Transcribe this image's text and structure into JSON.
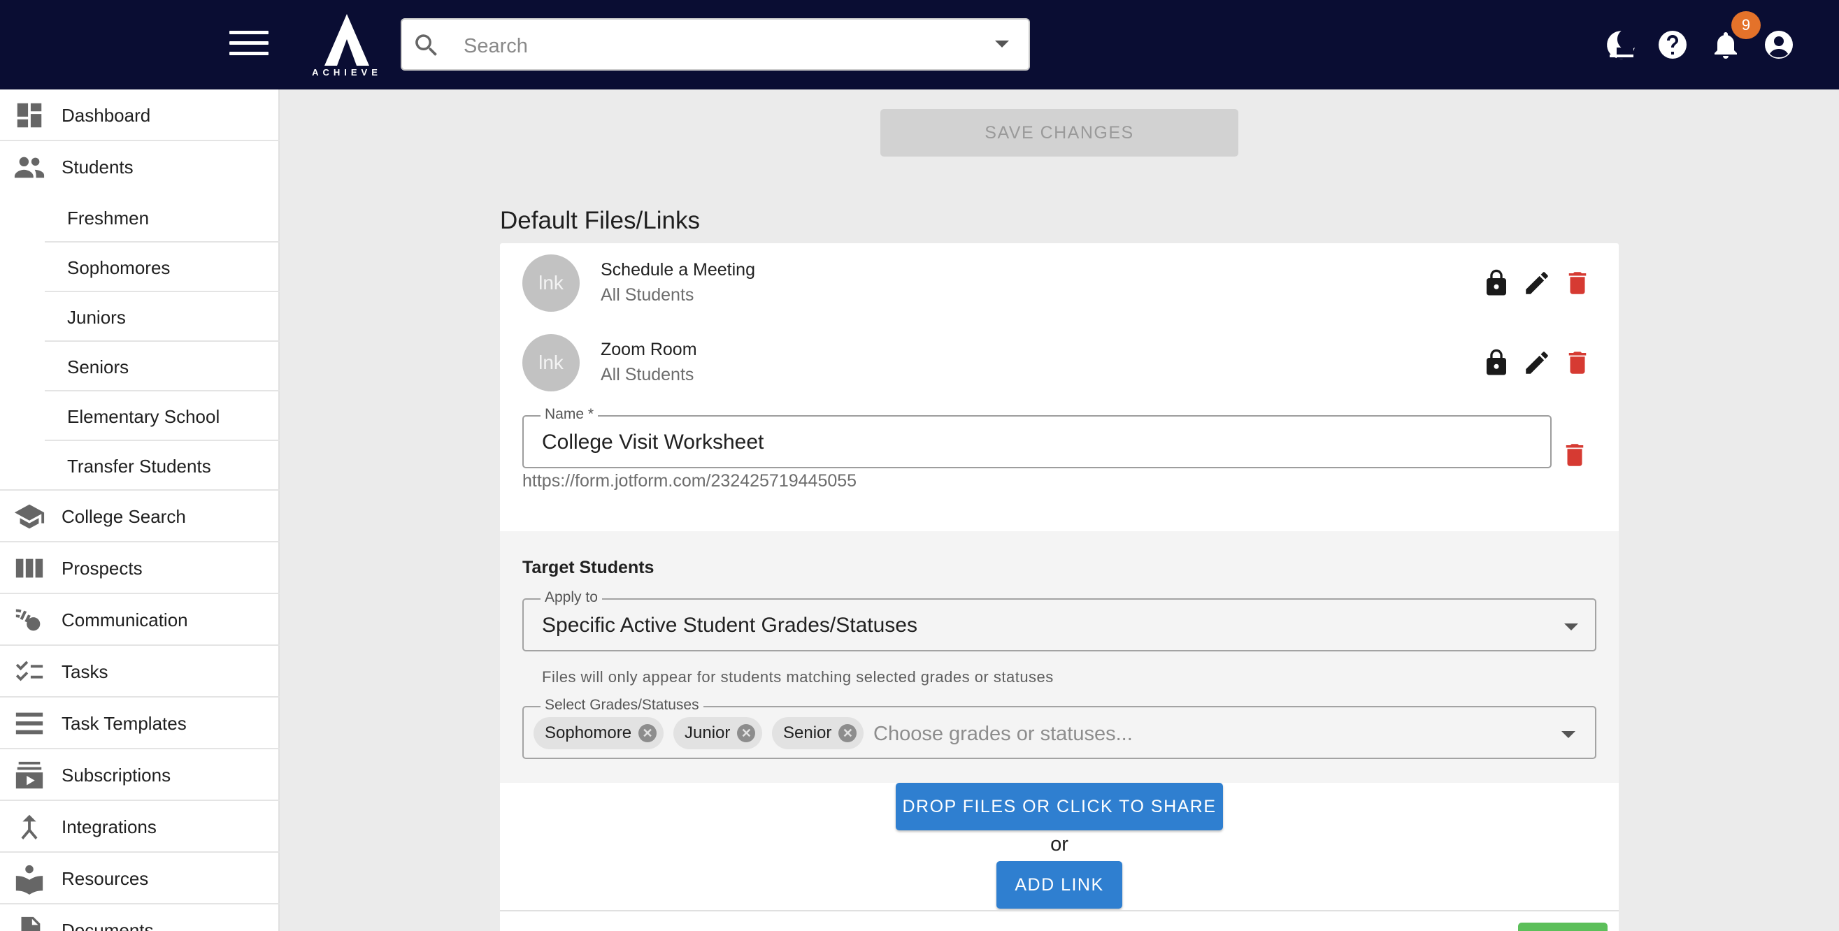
{
  "header": {
    "logo_text": "ACHIEVE",
    "search_placeholder": "Search",
    "notification_count": "9"
  },
  "sidebar": {
    "items": [
      {
        "label": "Dashboard",
        "icon": "dashboard-icon"
      },
      {
        "label": "Students",
        "icon": "people-icon"
      },
      {
        "label": "Freshmen"
      },
      {
        "label": "Sophomores"
      },
      {
        "label": "Juniors"
      },
      {
        "label": "Seniors"
      },
      {
        "label": "Elementary School"
      },
      {
        "label": "Transfer Students"
      },
      {
        "label": "College Search",
        "icon": "school-icon"
      },
      {
        "label": "Prospects",
        "icon": "columns-icon"
      },
      {
        "label": "Communication",
        "icon": "broadcast-icon"
      },
      {
        "label": "Tasks",
        "icon": "checklist-icon"
      },
      {
        "label": "Task Templates",
        "icon": "list-icon"
      },
      {
        "label": "Subscriptions",
        "icon": "subscriptions-icon"
      },
      {
        "label": "Integrations",
        "icon": "merge-icon"
      },
      {
        "label": "Resources",
        "icon": "reader-icon"
      },
      {
        "label": "Documents",
        "icon": "document-icon"
      }
    ]
  },
  "main": {
    "save_label": "SAVE CHANGES",
    "section_title": "Default Files/Links",
    "links": [
      {
        "avatar": "lnk",
        "title": "Schedule a Meeting",
        "audience": "All Students"
      },
      {
        "avatar": "lnk",
        "title": "Zoom Room",
        "audience": "All Students"
      }
    ],
    "name_field": {
      "label": "Name *",
      "value": "College Visit Worksheet"
    },
    "url": "https://form.jotform.com/232425719445055",
    "target": {
      "title": "Target Students",
      "apply_label": "Apply to",
      "apply_value": "Specific Active Student Grades/Statuses",
      "helper": "Files will only appear for students matching selected grades or statuses",
      "grades_label": "Select Grades/Statuses",
      "chips": [
        "Sophomore",
        "Junior",
        "Senior"
      ],
      "grades_placeholder": "Choose grades or statuses..."
    },
    "drop_label": "DROP FILES OR CLICK TO SHARE",
    "or_text": "or",
    "add_link_label": "ADD LINK"
  },
  "colors": {
    "topbar": "#0a0d33",
    "primary": "#2f7fd0",
    "delete": "#d63a32",
    "badge": "#e4722a",
    "success": "#5cbf5a"
  }
}
